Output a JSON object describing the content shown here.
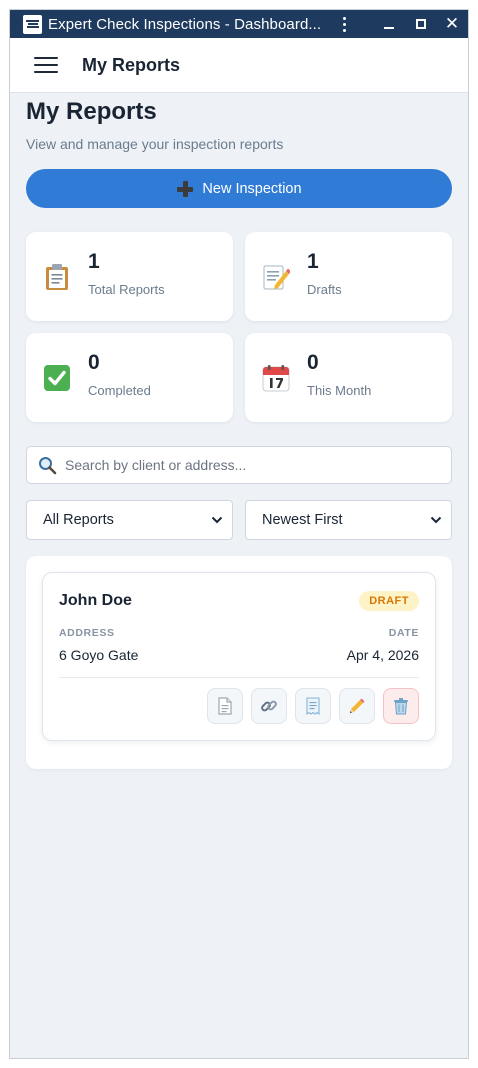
{
  "window": {
    "title": "Expert Check Inspections - Dashboard..."
  },
  "appbar": {
    "title": "My Reports"
  },
  "page": {
    "title": "My Reports",
    "subtitle": "View and manage your inspection reports"
  },
  "new_button": {
    "label": "New Inspection",
    "icon": "plus-icon"
  },
  "stats": [
    {
      "value": "1",
      "label": "Total Reports",
      "icon": "clipboard-icon"
    },
    {
      "value": "1",
      "label": "Drafts",
      "icon": "memo-icon"
    },
    {
      "value": "0",
      "label": "Completed",
      "icon": "check-icon"
    },
    {
      "value": "0",
      "label": "This Month",
      "icon": "calendar-icon"
    }
  ],
  "search": {
    "placeholder": "Search by client or address...",
    "value": ""
  },
  "filters": {
    "status": "All Reports",
    "sort": "Newest First"
  },
  "reports": [
    {
      "client": "John Doe",
      "status": "DRAFT",
      "address_label": "ADDRESS",
      "address": "6 Goyo Gate",
      "date_label": "DATE",
      "date": "Apr 4, 2026",
      "actions": [
        "document-icon",
        "link-icon",
        "receipt-icon",
        "pencil-icon",
        "trash-icon"
      ]
    }
  ],
  "colors": {
    "titlebar": "#1f3a5f",
    "accent": "#2f7bd6",
    "background": "#eef2f7",
    "draft_badge_bg": "#fef3c7",
    "draft_badge_text": "#d97706",
    "delete_bg": "#fdecec"
  }
}
